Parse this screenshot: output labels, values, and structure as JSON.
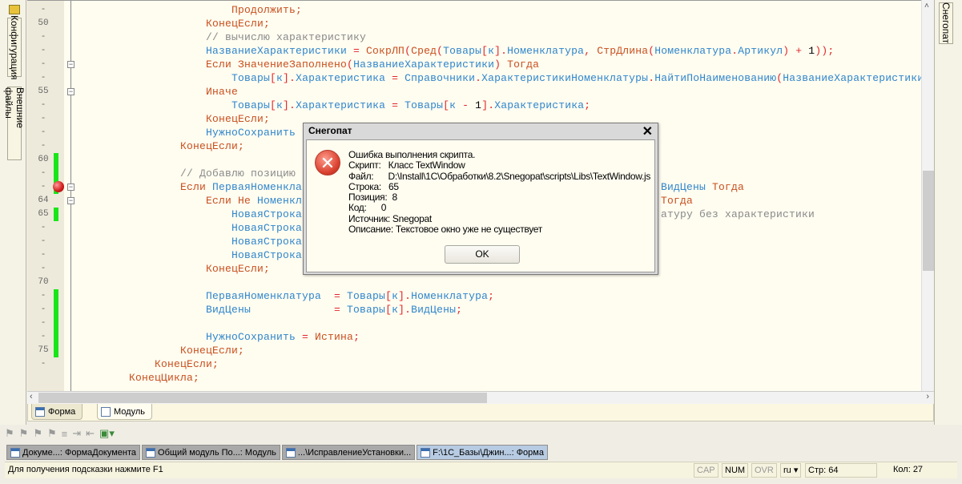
{
  "left_panel": {
    "tabs": [
      {
        "label": "Конфигурация"
      },
      {
        "label": "Внешние файлы"
      }
    ]
  },
  "right_panel": {
    "tabs": [
      {
        "label": "Снегопат"
      }
    ]
  },
  "editor": {
    "first_line": 49,
    "line_numbers": [
      "-",
      "50",
      "-",
      "-",
      "-",
      "-",
      "55",
      "-",
      "-",
      "-",
      "-",
      "60",
      "-",
      "-",
      "64",
      "65",
      "-",
      "-",
      "-",
      "-",
      "70",
      "-",
      "-",
      "-",
      "-",
      "75",
      "-"
    ],
    "changed_lines": [
      60,
      61,
      62,
      64,
      70,
      71,
      72,
      73,
      74
    ],
    "breakpoint_line": 62,
    "fold_lines": [
      53,
      55,
      62,
      63
    ],
    "lines": [
      {
        "indent": 24,
        "tokens": [
          {
            "t": "Продолжить;",
            "c": "k"
          }
        ]
      },
      {
        "indent": 20,
        "tokens": [
          {
            "t": "КонецЕсли;",
            "c": "k"
          }
        ]
      },
      {
        "indent": 20,
        "tokens": [
          {
            "t": "// вычислю характеристику",
            "c": "c"
          }
        ]
      },
      {
        "indent": 20,
        "tokens": [
          {
            "t": "НазваниеХарактеристики ",
            "c": "i"
          },
          {
            "t": "= ",
            "c": "o"
          },
          {
            "t": "СокрЛП",
            "c": "k"
          },
          {
            "t": "(",
            "c": "o"
          },
          {
            "t": "Сред",
            "c": "k"
          },
          {
            "t": "(",
            "c": "o"
          },
          {
            "t": "Товары",
            "c": "i"
          },
          {
            "t": "[",
            "c": "o"
          },
          {
            "t": "к",
            "c": "i"
          },
          {
            "t": "].",
            "c": "o"
          },
          {
            "t": "Номенклатура",
            "c": "i"
          },
          {
            "t": ", ",
            "c": "o"
          },
          {
            "t": "СтрДлина",
            "c": "k"
          },
          {
            "t": "(",
            "c": "o"
          },
          {
            "t": "Номенклатура",
            "c": "i"
          },
          {
            "t": ".",
            "c": "o"
          },
          {
            "t": "Артикул",
            "c": "i"
          },
          {
            "t": ") + ",
            "c": "o"
          },
          {
            "t": "1",
            "c": "n"
          },
          {
            "t": "));",
            "c": "o"
          }
        ]
      },
      {
        "indent": 20,
        "tokens": [
          {
            "t": "Если ",
            "c": "k"
          },
          {
            "t": "ЗначениеЗаполнено",
            "c": "k"
          },
          {
            "t": "(",
            "c": "o"
          },
          {
            "t": "НазваниеХарактеристики",
            "c": "i"
          },
          {
            "t": ") ",
            "c": "o"
          },
          {
            "t": "Тогда",
            "c": "k"
          }
        ]
      },
      {
        "indent": 24,
        "tokens": [
          {
            "t": "Товары",
            "c": "i"
          },
          {
            "t": "[",
            "c": "o"
          },
          {
            "t": "к",
            "c": "i"
          },
          {
            "t": "].",
            "c": "o"
          },
          {
            "t": "Характеристика ",
            "c": "i"
          },
          {
            "t": "= ",
            "c": "o"
          },
          {
            "t": "Справочники",
            "c": "i"
          },
          {
            "t": ".",
            "c": "o"
          },
          {
            "t": "ХарактеристикиНоменклатуры",
            "c": "i"
          },
          {
            "t": ".",
            "c": "o"
          },
          {
            "t": "НайтиПоНаименованию",
            "c": "i"
          },
          {
            "t": "(",
            "c": "o"
          },
          {
            "t": "НазваниеХарактеристики",
            "c": "i"
          }
        ]
      },
      {
        "indent": 20,
        "tokens": [
          {
            "t": "Иначе",
            "c": "k"
          }
        ]
      },
      {
        "indent": 24,
        "tokens": [
          {
            "t": "Товары",
            "c": "i"
          },
          {
            "t": "[",
            "c": "o"
          },
          {
            "t": "к",
            "c": "i"
          },
          {
            "t": "].",
            "c": "o"
          },
          {
            "t": "Характеристика ",
            "c": "i"
          },
          {
            "t": "= ",
            "c": "o"
          },
          {
            "t": "Товары",
            "c": "i"
          },
          {
            "t": "[",
            "c": "o"
          },
          {
            "t": "к ",
            "c": "i"
          },
          {
            "t": "- ",
            "c": "o"
          },
          {
            "t": "1",
            "c": "n"
          },
          {
            "t": "].",
            "c": "o"
          },
          {
            "t": "Характеристика",
            "c": "i"
          },
          {
            "t": ";",
            "c": "o"
          }
        ]
      },
      {
        "indent": 20,
        "tokens": [
          {
            "t": "КонецЕсли;",
            "c": "k"
          }
        ]
      },
      {
        "indent": 20,
        "tokens": [
          {
            "t": "НужноСохранить ",
            "c": "i"
          }
        ]
      },
      {
        "indent": 16,
        "tokens": [
          {
            "t": "КонецЕсли;",
            "c": "k"
          }
        ]
      },
      {
        "indent": 16,
        "tokens": []
      },
      {
        "indent": 16,
        "tokens": [
          {
            "t": "// Добавлю позицию",
            "c": "c"
          }
        ]
      },
      {
        "indent": 16,
        "tokens": [
          {
            "t": "Если ",
            "c": "k"
          },
          {
            "t": "ПерваяНоменкла",
            "c": "i"
          }
        ],
        "right": [
          {
            "t": "ВидЦены ",
            "c": "i"
          },
          {
            "t": "Тогда",
            "c": "k"
          }
        ]
      },
      {
        "indent": 20,
        "tokens": [
          {
            "t": "Если Не ",
            "c": "k"
          },
          {
            "t": "Номенкл",
            "c": "i"
          }
        ],
        "right": [
          {
            "t": "Тогда",
            "c": "k"
          }
        ]
      },
      {
        "indent": 24,
        "tokens": [
          {
            "t": "НоваяСтрока",
            "c": "i"
          }
        ],
        "right": [
          {
            "t": "атуру без характеристики",
            "c": "c"
          }
        ]
      },
      {
        "indent": 24,
        "tokens": [
          {
            "t": "НоваяСтрока",
            "c": "i"
          }
        ]
      },
      {
        "indent": 24,
        "tokens": [
          {
            "t": "НоваяСтрока",
            "c": "i"
          }
        ]
      },
      {
        "indent": 24,
        "tokens": [
          {
            "t": "НоваяСтрока",
            "c": "i"
          }
        ]
      },
      {
        "indent": 20,
        "tokens": [
          {
            "t": "КонецЕсли;",
            "c": "k"
          }
        ]
      },
      {
        "indent": 20,
        "tokens": []
      },
      {
        "indent": 20,
        "tokens": [
          {
            "t": "ПерваяНоменклатура  ",
            "c": "i"
          },
          {
            "t": "= ",
            "c": "o"
          },
          {
            "t": "Товары",
            "c": "i"
          },
          {
            "t": "[",
            "c": "o"
          },
          {
            "t": "к",
            "c": "i"
          },
          {
            "t": "].",
            "c": "o"
          },
          {
            "t": "Номенклатура",
            "c": "i"
          },
          {
            "t": ";",
            "c": "o"
          }
        ]
      },
      {
        "indent": 20,
        "tokens": [
          {
            "t": "ВидЦены             ",
            "c": "i"
          },
          {
            "t": "= ",
            "c": "o"
          },
          {
            "t": "Товары",
            "c": "i"
          },
          {
            "t": "[",
            "c": "o"
          },
          {
            "t": "к",
            "c": "i"
          },
          {
            "t": "].",
            "c": "o"
          },
          {
            "t": "ВидЦены",
            "c": "i"
          },
          {
            "t": ";",
            "c": "o"
          }
        ]
      },
      {
        "indent": 20,
        "tokens": []
      },
      {
        "indent": 20,
        "tokens": [
          {
            "t": "НужноСохранить ",
            "c": "i"
          },
          {
            "t": "= ",
            "c": "o"
          },
          {
            "t": "Истина",
            "c": "k"
          },
          {
            "t": ";",
            "c": "o"
          }
        ]
      },
      {
        "indent": 16,
        "tokens": [
          {
            "t": "КонецЕсли;",
            "c": "k"
          }
        ]
      },
      {
        "indent": 12,
        "tokens": [
          {
            "t": "КонецЕсли;",
            "c": "k"
          }
        ]
      },
      {
        "indent": 8,
        "tokens": [
          {
            "t": "КонецЦикла;",
            "c": "k"
          }
        ]
      }
    ]
  },
  "bottom_tabs": [
    {
      "label": "Форма",
      "active": false
    },
    {
      "label": "Модуль",
      "active": true
    }
  ],
  "window_tabs": [
    {
      "label": "Докуме...: ФормаДокумента"
    },
    {
      "label": "Общий модуль По...: Модуль"
    },
    {
      "label": "...\\ИсправлениеУстановки..."
    },
    {
      "label": "F:\\1C_Базы\\Джин...: Форма",
      "active": true
    }
  ],
  "status": {
    "hint": "Для получения подсказки нажмите F1",
    "cap": "CAP",
    "num": "NUM",
    "ovr": "OVR",
    "lang": "ru ▾",
    "row": "Стр: 64",
    "col": "Кол: 27"
  },
  "dialog": {
    "title": "Снегопат",
    "lines": [
      "Ошибка выполнения скрипта.",
      "Скрипт:   Класс TextWindow",
      "Файл:      D:\\Install\\1C\\Обработки\\8.2\\Snegopat\\scripts\\Libs\\TextWindow.js",
      "Строка:   65",
      "Позиция:  8",
      "Код:      0",
      "Источник: Snegopat",
      "Описание: Текстовое окно уже не существует"
    ],
    "ok_label": "OK",
    "icon": "error-icon"
  },
  "colors": {
    "keyword": "#c8501e",
    "identifier": "#2f86cc",
    "operator": "#e0282a",
    "comment": "#8a8a8a",
    "editor_bg": "#fffcf0",
    "changed_marker": "#19e619"
  }
}
